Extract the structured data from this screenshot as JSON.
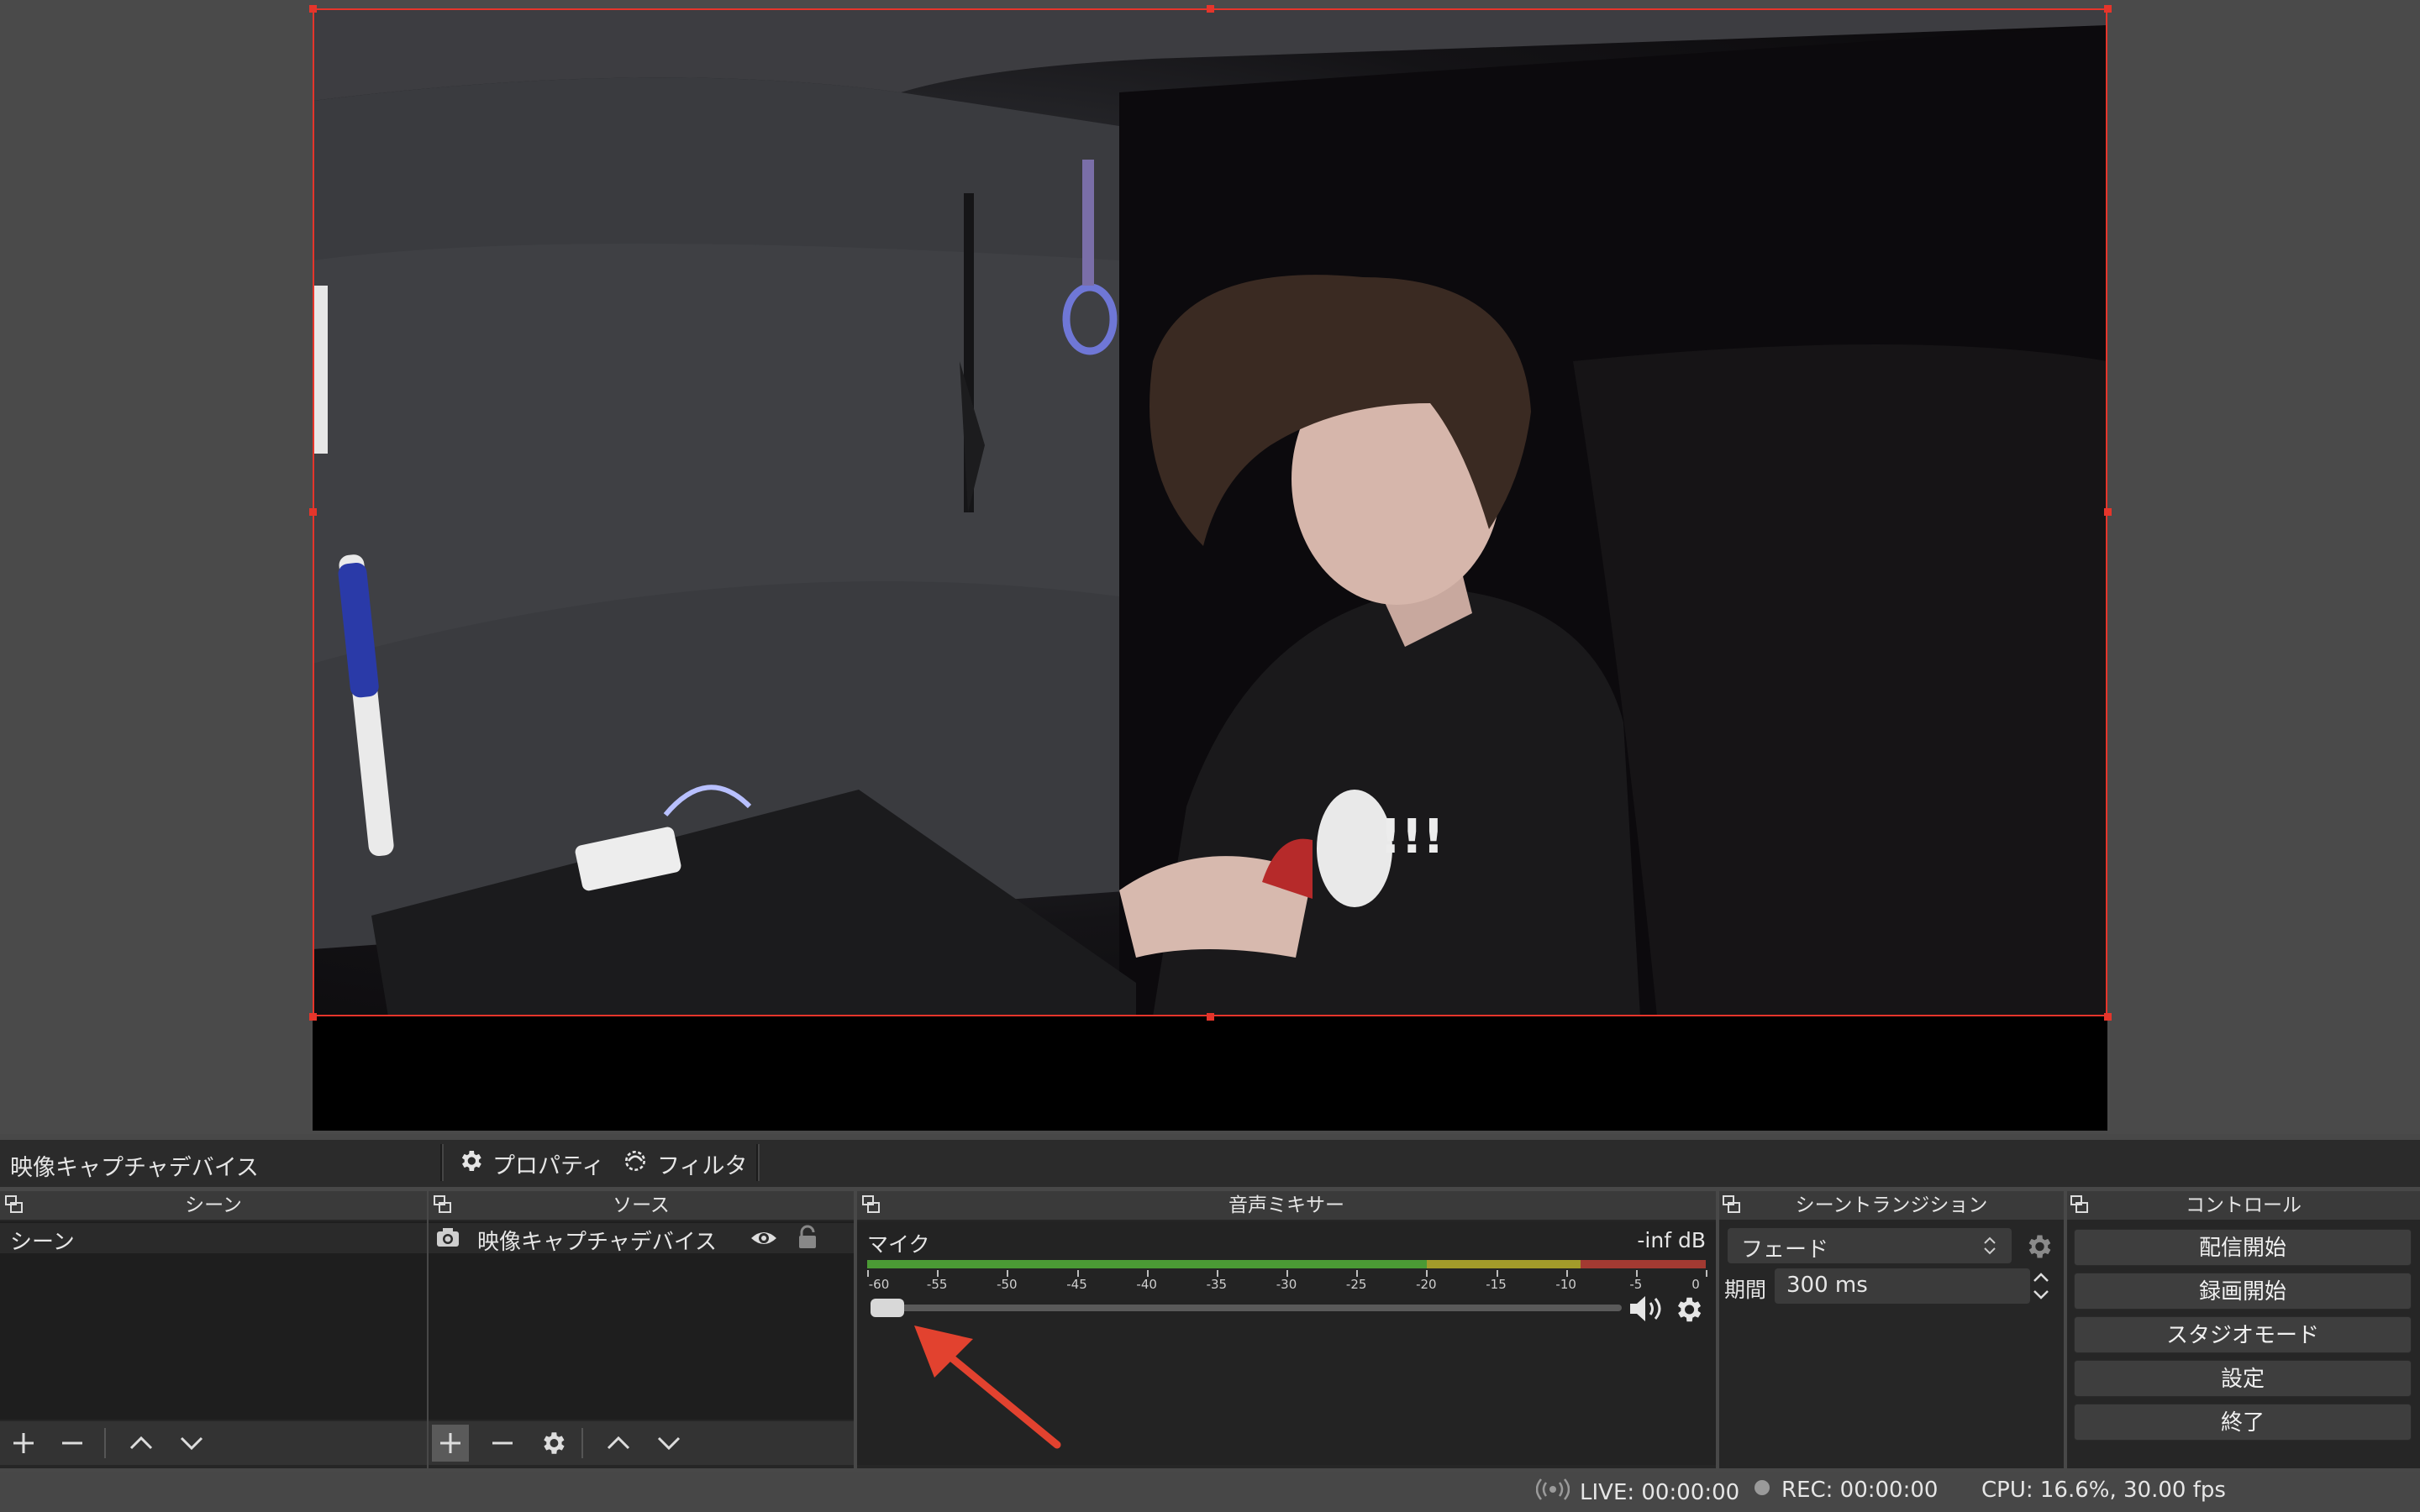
{
  "app": {
    "accent": "#e5352b"
  },
  "toolbar": {
    "selected_source": "映像キャプチャデバイス",
    "properties_label": "プロパティ",
    "filters_label": "フィルタ"
  },
  "scenes": {
    "title": "シーン",
    "items": [
      "シーン"
    ]
  },
  "sources": {
    "title": "ソース",
    "items": [
      {
        "name": "映像キャプチャデバイス",
        "icon": "camera-icon"
      }
    ]
  },
  "mixer": {
    "title": "音声ミキサー",
    "channel": {
      "name": "マイク",
      "level": "-inf dB",
      "ticks": [
        "-60",
        "-55",
        "-50",
        "-45",
        "-40",
        "-35",
        "-30",
        "-25",
        "-20",
        "-15",
        "-10",
        "-5",
        "0"
      ],
      "volume_fraction": 0.0
    }
  },
  "transitions": {
    "title": "シーントランジション",
    "selected": "フェード",
    "duration_label": "期間",
    "duration_value": "300 ms"
  },
  "controls": {
    "title": "コントロール",
    "buttons": [
      "配信開始",
      "録画開始",
      "スタジオモード",
      "設定",
      "終了"
    ]
  },
  "status": {
    "live": "LIVE: 00:00:00",
    "rec": "REC: 00:00:00",
    "cpu": "CPU: 16.6%, 30.00 fps"
  }
}
